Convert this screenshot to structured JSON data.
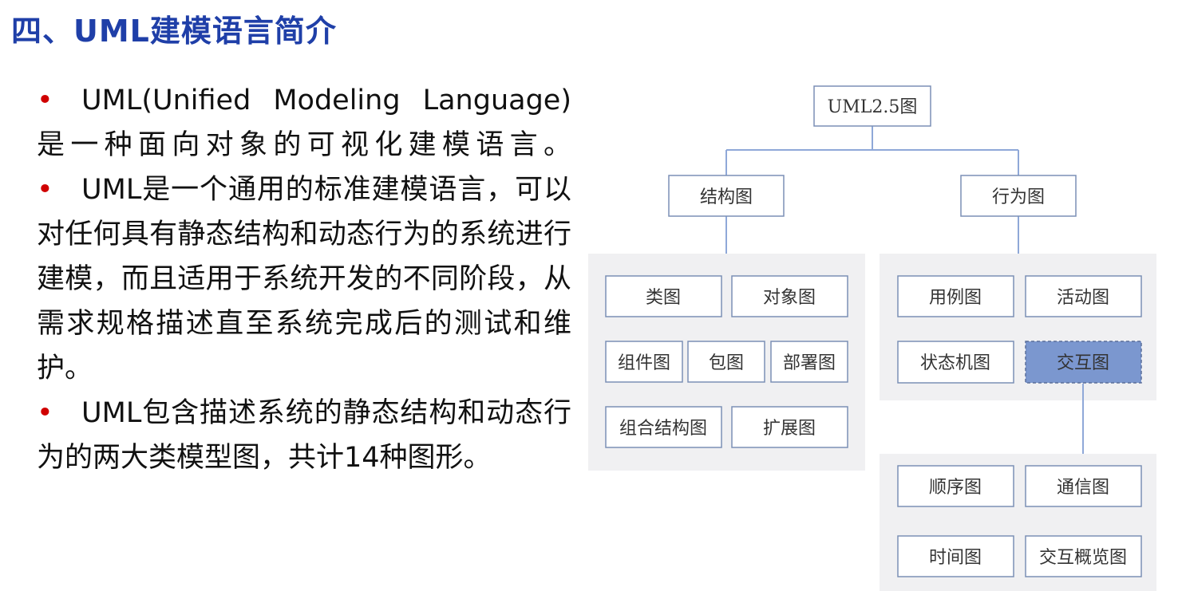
{
  "title": "四、UML建模语言简介",
  "bullets": [
    "UML(Unified Modeling Language)是一种面向对象的可视化建模语言。",
    "UML是一个通用的标准建模语言，可以对任何具有静态结构和动态行为的系统进行建模，而且适用于系统开发的不同阶段，从需求规格描述直至系统完成后的测试和维护。",
    "UML包含描述系统的静态结构和动态行为的两大类模型图，共计14种图形。"
  ],
  "diagram": {
    "root": "UML2.5图",
    "structure": {
      "label": "结构图",
      "children": [
        "类图",
        "对象图",
        "组件图",
        "包图",
        "部署图",
        "组合结构图",
        "扩展图"
      ]
    },
    "behavior": {
      "label": "行为图",
      "children": [
        "用例图",
        "活动图",
        "状态机图",
        "交互图"
      ]
    },
    "interaction": {
      "children": [
        "顺序图",
        "通信图",
        "时间图",
        "交互概览图"
      ]
    },
    "colors": {
      "box_border": "#7b8fb5",
      "panel_bg": "#f0f0f2",
      "line": "#8fa8d8",
      "highlight_fill": "#7b97cf"
    }
  }
}
